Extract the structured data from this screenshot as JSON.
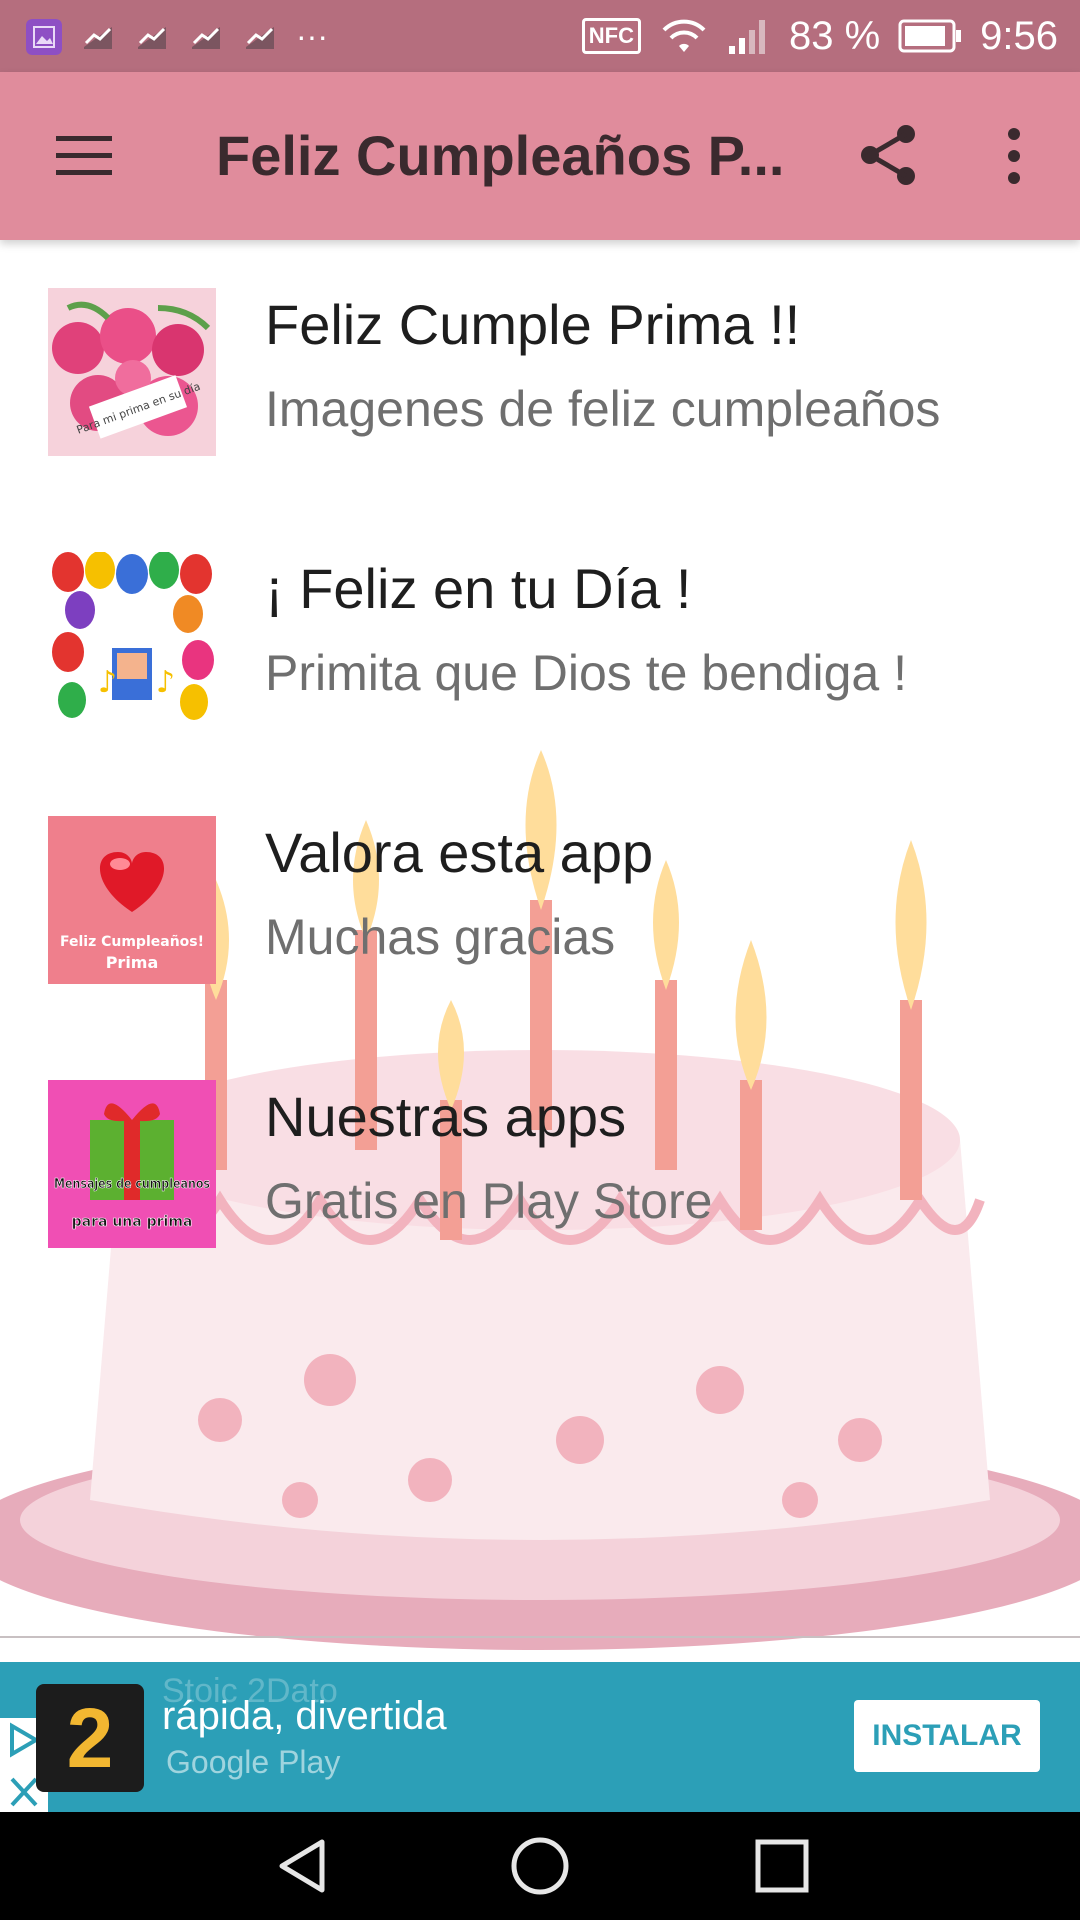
{
  "status_bar": {
    "battery_percent": "83 %",
    "time": "9:56",
    "nfc_label": "NFC",
    "more_label": "···"
  },
  "app_bar": {
    "title": "Feliz Cumpleaños P..."
  },
  "items": [
    {
      "title": "Feliz Cumple Prima !!",
      "subtitle": "Imagenes de feliz cumpleaños",
      "thumb_caption": "Para mi prima en su día"
    },
    {
      "title": "¡ Feliz en tu Día !",
      "subtitle": "Primita que Dios te bendiga !"
    },
    {
      "title": "Valora esta app",
      "subtitle": "Muchas gracias",
      "thumb_caption_1": "Feliz Cumpleaños!",
      "thumb_caption_2": "Prima"
    },
    {
      "title": "Nuestras apps",
      "subtitle": "Gratis en Play Store",
      "thumb_caption_1": "Mensajes de cumpleanos",
      "thumb_caption_2": "para una prima"
    }
  ],
  "ad": {
    "logo_digit": "2",
    "headline": "rápida, divertida",
    "ghost_text": "Stoic 2Dato",
    "store": "Google Play",
    "install_label": "INSTALAR"
  },
  "colors": {
    "status_bar": "#b56e7e",
    "app_bar": "#e08c9c",
    "ad_background": "#2c9fb7"
  },
  "icons": [
    "menu-icon",
    "share-icon",
    "more-vert-icon",
    "ad-choices-icon",
    "close-icon",
    "back-icon",
    "home-icon",
    "recents-icon"
  ]
}
